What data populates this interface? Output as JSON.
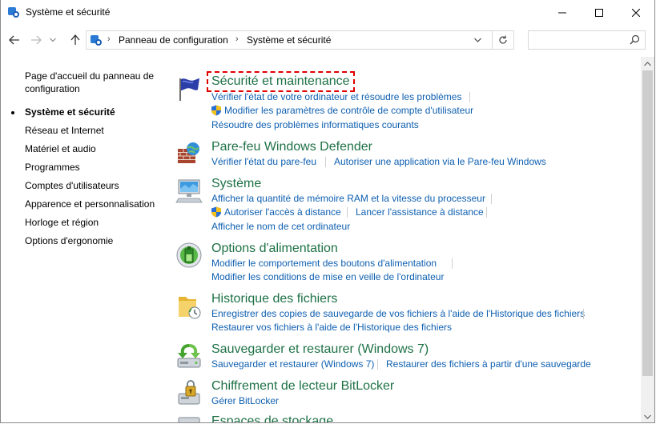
{
  "window": {
    "title": "Système et sécurité"
  },
  "address": {
    "crumbs": [
      "Panneau de configuration",
      "Système et sécurité"
    ],
    "search_placeholder": ""
  },
  "leftnav": {
    "items": [
      {
        "label": "Page d'accueil du panneau de configuration",
        "current": false
      },
      {
        "label": "Système et sécurité",
        "current": true
      },
      {
        "label": "Réseau et Internet",
        "current": false
      },
      {
        "label": "Matériel et audio",
        "current": false
      },
      {
        "label": "Programmes",
        "current": false
      },
      {
        "label": "Comptes d'utilisateurs",
        "current": false
      },
      {
        "label": "Apparence et personnalisation",
        "current": false
      },
      {
        "label": "Horloge et région",
        "current": false
      },
      {
        "label": "Options d'ergonomie",
        "current": false
      }
    ]
  },
  "sections": [
    {
      "title": "Sécurité et maintenance",
      "icon": "flag-icon",
      "links": [
        "Vérifier l'état de votre ordinateur et résoudre les problèmes",
        "Modifier les paramètres de contrôle de compte d'utilisateur",
        "Résoudre des problèmes informatiques courants"
      ]
    },
    {
      "title": "Pare-feu Windows Defender",
      "icon": "firewall-icon",
      "links": [
        "Vérifier l'état du pare-feu",
        "Autoriser une application via le Pare-feu Windows"
      ]
    },
    {
      "title": "Système",
      "icon": "computer-icon",
      "links": [
        "Afficher la quantité de mémoire RAM et la vitesse du processeur",
        "Autoriser l'accès à distance",
        "Lancer l'assistance à distance",
        "Afficher le nom de cet ordinateur"
      ]
    },
    {
      "title": "Options d'alimentation",
      "icon": "power-options-icon",
      "links": [
        "Modifier le comportement des boutons d'alimentation",
        "Modifier les conditions de mise en veille de l'ordinateur"
      ]
    },
    {
      "title": "Historique des fichiers",
      "icon": "file-history-icon",
      "links": [
        "Enregistrer des copies de sauvegarde de vos fichiers à l'aide de l'Historique des fichiers",
        "Restaurer vos fichiers à l'aide de l'Historique des fichiers"
      ]
    },
    {
      "title": "Sauvegarder et restaurer (Windows 7)",
      "icon": "backup-restore-icon",
      "links": [
        "Sauvegarder et restaurer (Windows 7)",
        "Restaurer des fichiers à partir d'une sauvegarde"
      ]
    },
    {
      "title": "Chiffrement de lecteur BitLocker",
      "icon": "bitlocker-icon",
      "links": [
        "Gérer BitLocker"
      ]
    },
    {
      "title": "Espaces de stockage",
      "icon": "storage-spaces-icon",
      "links": []
    }
  ],
  "colors": {
    "section_title": "#1e7145",
    "link": "#0e5fb0",
    "highlight_outline": "#e00000"
  }
}
